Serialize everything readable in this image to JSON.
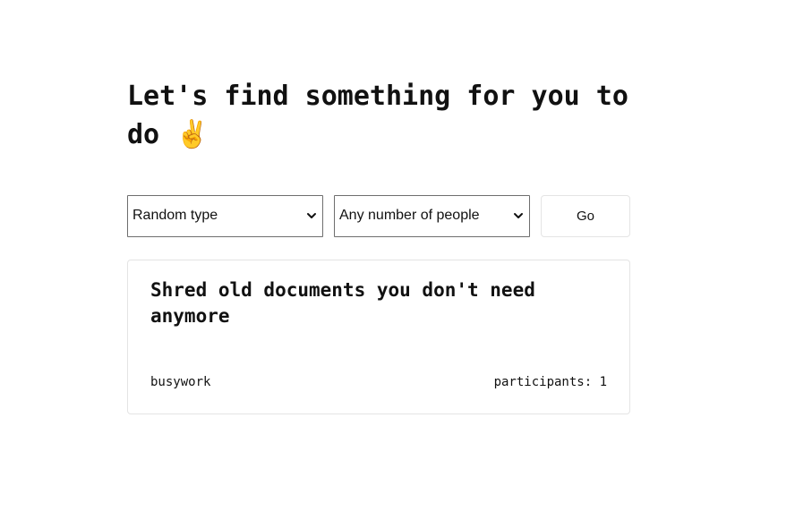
{
  "page": {
    "title": "Let's find something for you to do ✌️"
  },
  "controls": {
    "type_select": {
      "selected": "Random type",
      "icon": "chevron-down-icon"
    },
    "participants_select": {
      "selected": "Any number of people",
      "icon": "chevron-down-icon"
    },
    "go_label": "Go"
  },
  "activity": {
    "title": "Shred old documents you don't need anymore",
    "type": "busywork",
    "participants_label": "participants: 1"
  }
}
